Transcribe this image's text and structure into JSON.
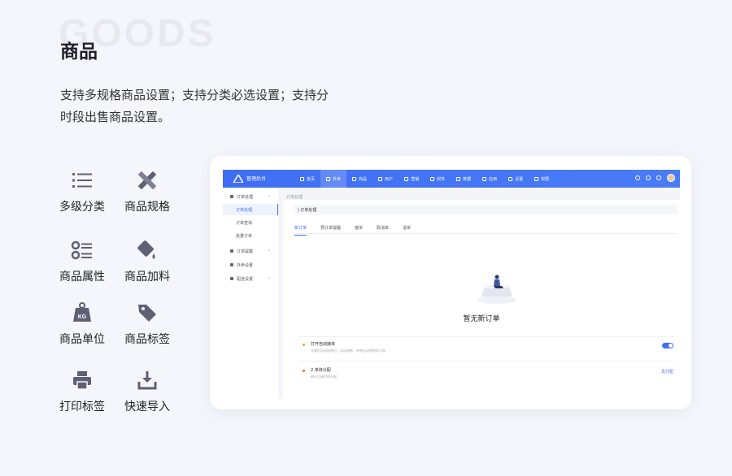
{
  "section": {
    "watermark": "GOODS",
    "title": "商品",
    "description": "支持多规格商品设置；支持分类必选设置；支持分时段出售商品设置。"
  },
  "features": [
    {
      "label": "多级分类",
      "icon": "list-icon"
    },
    {
      "label": "商品规格",
      "icon": "pencil-ruler-icon"
    },
    {
      "label": "商品属性",
      "icon": "attributes-icon"
    },
    {
      "label": "商品加料",
      "icon": "paint-bucket-icon"
    },
    {
      "label": "商品单位",
      "icon": "kg-weight-icon"
    },
    {
      "label": "商品标签",
      "icon": "tag-icon"
    },
    {
      "label": "打印标签",
      "icon": "printer-icon"
    },
    {
      "label": "快速导入",
      "icon": "import-icon"
    }
  ],
  "mockup": {
    "brand": "管理后台",
    "nav": [
      {
        "label": "首页"
      },
      {
        "label": "外卖"
      },
      {
        "label": "商品"
      },
      {
        "label": "用户"
      },
      {
        "label": "营销"
      },
      {
        "label": "财务"
      },
      {
        "label": "数据"
      },
      {
        "label": "应用"
      },
      {
        "label": "设置"
      },
      {
        "label": "权限"
      }
    ],
    "active_nav": 1,
    "sidebar": [
      {
        "label": "订单处理",
        "type": "group"
      },
      {
        "label": "订单处理",
        "type": "sub",
        "active": true
      },
      {
        "label": "订单查询",
        "type": "sub"
      },
      {
        "label": "批量订单",
        "type": "sub"
      },
      {
        "label": "订单提醒",
        "type": "group"
      },
      {
        "label": "外卖设置",
        "type": "group"
      },
      {
        "label": "配送设置",
        "type": "group"
      }
    ],
    "breadcrumb": "订单处理",
    "panel_title": "| 订单处理",
    "tabs": [
      {
        "label": "新订单"
      },
      {
        "label": "预订单提醒"
      },
      {
        "label": "催单"
      },
      {
        "label": "取消单"
      },
      {
        "label": "退单"
      }
    ],
    "empty_text": "暂无新订单",
    "options": [
      {
        "title": "打开自动接单",
        "subtitle": "开通后自动接单后，自动接单，有新自动接单的订单",
        "action": "toggle",
        "dot_color": "#f5a623"
      },
      {
        "title": "2 单待分配",
        "subtitle": "确认后请尽快分配",
        "action": "link",
        "action_label": "去分配",
        "dot_color": "#e8632e"
      }
    ],
    "colors": {
      "primary": "#3f6ef3"
    }
  }
}
